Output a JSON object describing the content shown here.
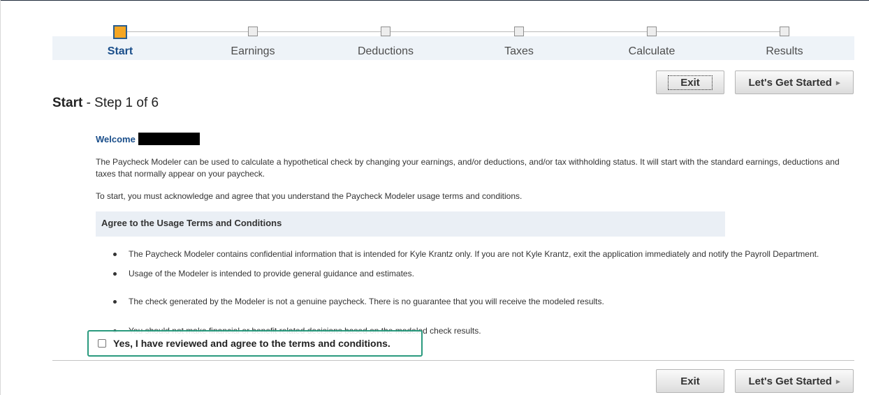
{
  "tracker": {
    "steps": [
      {
        "label": "Start",
        "active": true
      },
      {
        "label": "Earnings",
        "active": false
      },
      {
        "label": "Deductions",
        "active": false
      },
      {
        "label": "Taxes",
        "active": false
      },
      {
        "label": "Calculate",
        "active": false
      },
      {
        "label": "Results",
        "active": false
      }
    ]
  },
  "header": {
    "title_strong": "Start",
    "title_rest": " - Step 1 of 6"
  },
  "buttons": {
    "exit_label": "Exit",
    "start_label": "Let's Get Started"
  },
  "content": {
    "welcome_label": "Welcome",
    "intro_text": "The Paycheck Modeler can be used to calculate a hypothetical check by changing your earnings, and/or deductions, and/or tax withholding status. It will start with the standard earnings, deductions and taxes that normally appear on your paycheck.",
    "ack_text": "To start, you must acknowledge and agree that you understand the Paycheck Modeler usage terms and conditions.",
    "terms_heading": "Agree to the Usage Terms and Conditions",
    "terms": [
      "The Paycheck Modeler contains confidential information that is intended for Kyle Krantz only. If you are not Kyle Krantz, exit the application immediately and notify the Payroll Department.",
      "Usage of the Modeler is intended to provide general guidance and estimates.",
      "The check generated by the Modeler is not a genuine paycheck. There is no guarantee that you will receive the modeled results.",
      "You should not make financial or benefit related decisions based on the modeled check results."
    ],
    "agree_label": "Yes, I have reviewed and agree to the terms and conditions."
  },
  "colors": {
    "active_step": "#f5a623",
    "link_blue": "#1a4e8a",
    "highlight_border": "#2a9a7e",
    "band": "#eef3f8"
  }
}
